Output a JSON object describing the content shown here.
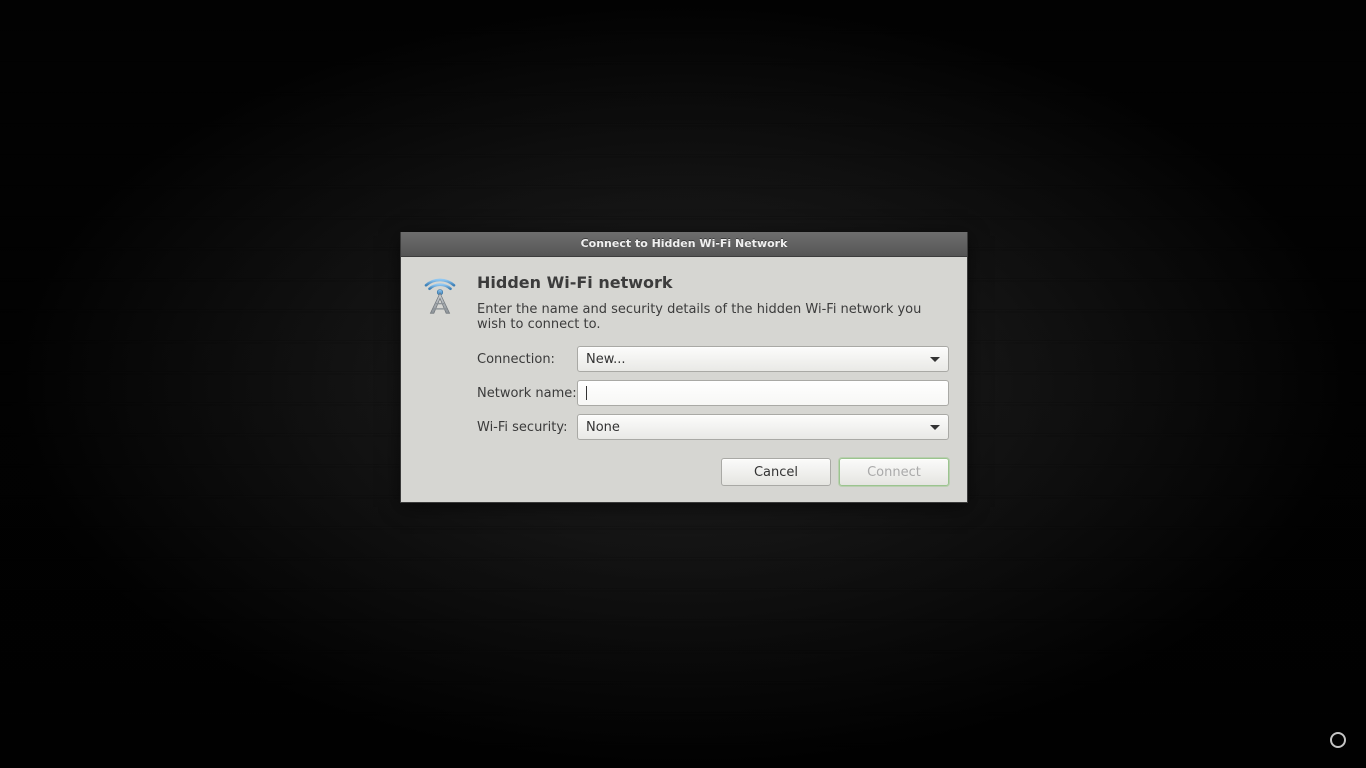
{
  "dialog": {
    "title": "Connect to Hidden Wi-Fi Network",
    "heading": "Hidden Wi-Fi network",
    "description": "Enter the name and security details of the hidden Wi-Fi network you wish to connect to.",
    "labels": {
      "connection": "Connection:",
      "network_name": "Network name:",
      "wifi_security": "Wi-Fi security:"
    },
    "fields": {
      "connection_value": "New...",
      "network_name_value": "",
      "wifi_security_value": "None"
    },
    "buttons": {
      "cancel": "Cancel",
      "connect": "Connect"
    }
  }
}
